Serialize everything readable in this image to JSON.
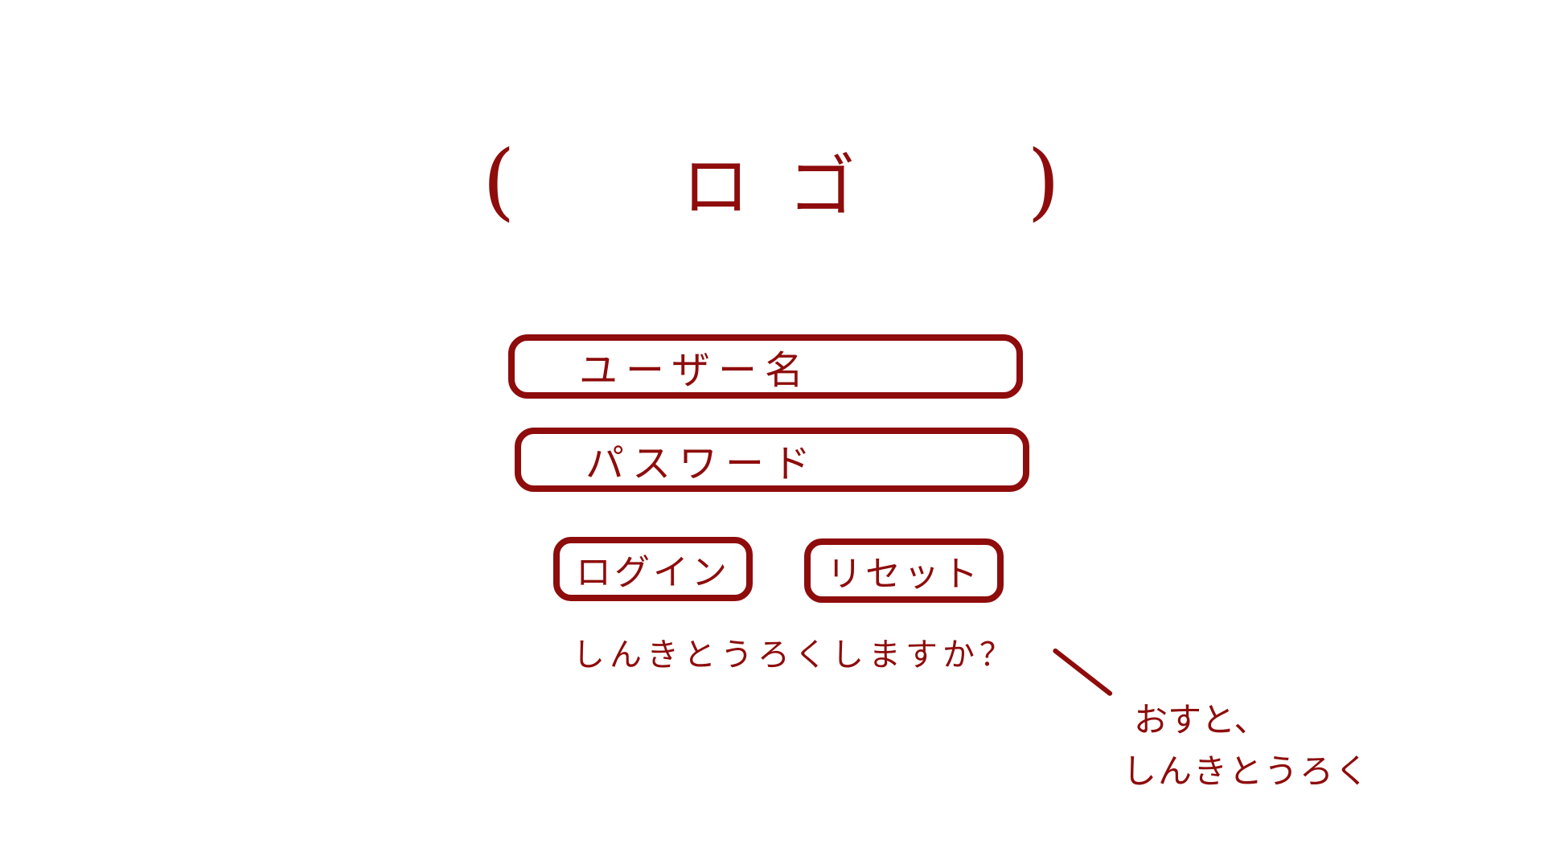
{
  "logo": {
    "open_bracket": "(",
    "text": "ロゴ",
    "close_bracket": ")"
  },
  "form": {
    "username_placeholder": "ユーザー名",
    "password_placeholder": "パスワード"
  },
  "buttons": {
    "login_label": "ログイン",
    "reset_label": "リセット"
  },
  "register_link": "しんきとうろくしますか？",
  "annotation": {
    "line1": "おすと、",
    "line2": "しんきとうろく"
  },
  "colors": {
    "ink": "#8e0c0c",
    "background": "#ffffff"
  }
}
